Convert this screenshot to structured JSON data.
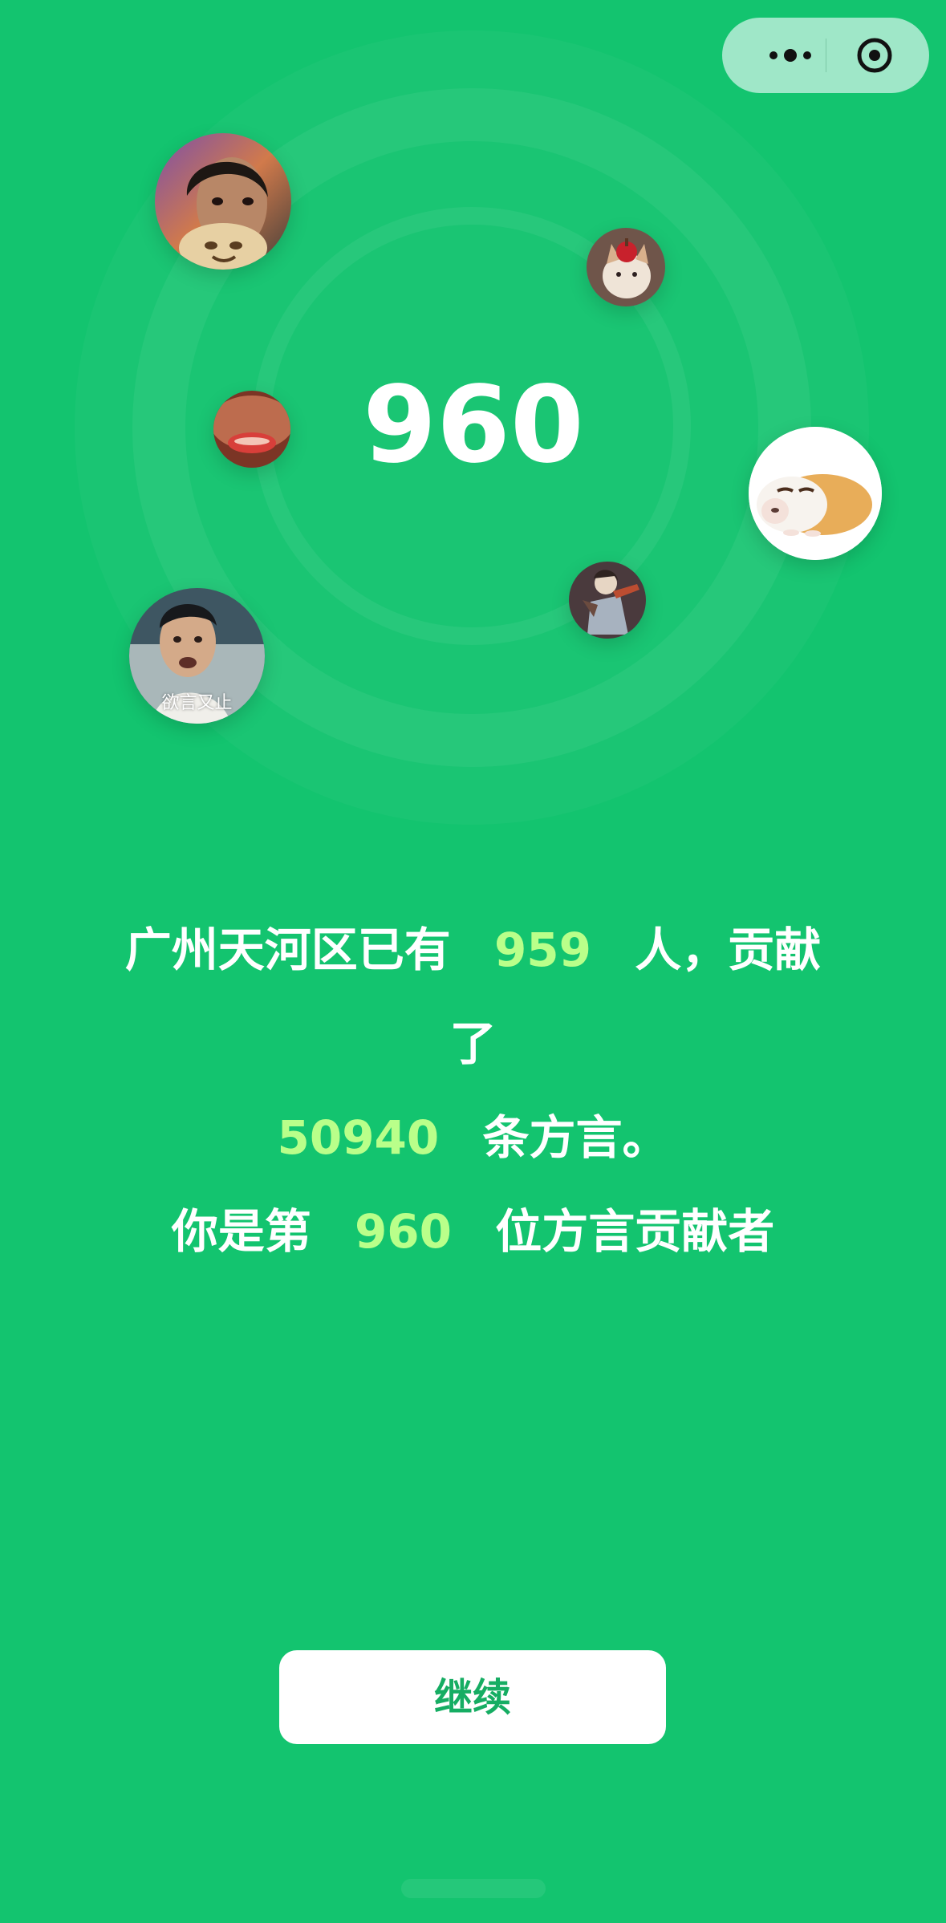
{
  "header": {
    "menu_icon": "more-icon",
    "target_icon": "record-icon"
  },
  "hero": {
    "count": "960"
  },
  "avatars": [
    {
      "name": "woman-with-cookie",
      "caption": ""
    },
    {
      "name": "kitten-with-apple",
      "caption": ""
    },
    {
      "name": "close-up-mouth",
      "caption": ""
    },
    {
      "name": "sleeping-guinea-pig",
      "caption": ""
    },
    {
      "name": "game-character",
      "caption": ""
    },
    {
      "name": "man-speaking",
      "caption": "欲言又止"
    }
  ],
  "summary": {
    "line1_prefix": "广州天河区已有",
    "people_count": "959",
    "line1_suffix": "人，贡献",
    "line2": "了",
    "dialect_count": "50940",
    "line3_suffix": "条方言。",
    "line4_prefix": "你是第",
    "rank": "960",
    "line4_suffix": "位方言贡献者"
  },
  "actions": {
    "continue_label": "继续"
  },
  "colors": {
    "background": "#13c46f",
    "highlight": "#b9ff8a",
    "button_text": "#16ad63"
  }
}
